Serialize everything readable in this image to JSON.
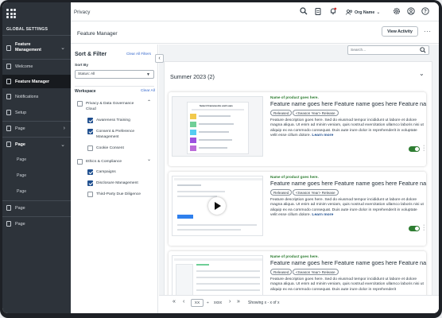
{
  "topbar": {
    "title": "Privacy",
    "org_name": "Org Name"
  },
  "sidebar": {
    "header": "GLOBAL SETTINGS",
    "items": [
      {
        "label": "Feature Management"
      },
      {
        "label": "Welcome"
      },
      {
        "label": "Feature Manager"
      },
      {
        "label": "Notifications"
      },
      {
        "label": "Setup"
      },
      {
        "label": "Page"
      },
      {
        "label": "Page"
      },
      {
        "label": "Page"
      },
      {
        "label": "Page"
      },
      {
        "label": "Page"
      },
      {
        "label": "Page"
      },
      {
        "label": "Page"
      }
    ]
  },
  "page": {
    "title": "Feature Manager",
    "view_activity": "View Activity"
  },
  "filter": {
    "title": "Sort & Filter",
    "clear_all": "Clear All Filters",
    "sort_label": "Sort By",
    "sort_value": "Status: All",
    "workspace_label": "Workspace",
    "workspace_clear": "Clear All",
    "groups": [
      {
        "label": "Privacy & Data Governance Cloud",
        "checked": false,
        "children": [
          {
            "label": "Awareness Training",
            "checked": true
          },
          {
            "label": "Consent & Preference Management",
            "checked": true
          },
          {
            "label": "Cookie Consent",
            "checked": false
          }
        ]
      },
      {
        "label": "Ethics & Compliance",
        "checked": false,
        "children": [
          {
            "label": "Campaigns",
            "checked": true
          },
          {
            "label": "Disclosure Management",
            "checked": true
          },
          {
            "label": "Third-Party Due Diligence",
            "checked": false
          }
        ]
      }
    ]
  },
  "main": {
    "search_placeholder": "Search...",
    "release_title": "Summer 2023 (2)",
    "cards": [
      {
        "product": "Name of product goes here.",
        "feature": "Feature name goes here Feature name goes here Feature na",
        "status": "Released",
        "season": "<Season Year> Release",
        "description": "Feature description goes here. Sed do eiusmod tempor incididunt ut labore et dolore magna aliqua. Ut enim ad minim veniam, quis nostrud exercitation ullamco laboris nisi ut aliquip ex ea commodo consequat. Duis aute irure dolor in reprehenderit in voluptate velit esse cillum dolore.",
        "learn_more": "Learn more",
        "thumb_heading": "Select Frameworks and Laws"
      },
      {
        "product": "Name of product goes here.",
        "feature": "Feature name goes here Feature name goes here Feature na",
        "status": "Released",
        "season": "<Season Year> Release",
        "description": "Feature description goes here. Sed do eiusmod tempor incididunt ut labore et dolore magna aliqua. Ut enim ad minim veniam, quis nostrud exercitation ullamco laboris nisi ut aliquip ex ea commodo consequat. Duis aute irure dolor in reprehenderit in voluptate velit esse cillum dolore.",
        "learn_more": "Learn more"
      },
      {
        "product": "Name of product goes here.",
        "feature": "Feature name goes here Feature name goes here Feature na",
        "status": "Released",
        "season": "<Season Year> Release",
        "description": "Feature description goes here. Sed do eiusmod tempor incididunt ut labore et dolore magna aliqua. Ut enim ad minim veniam, quis nostrud exercitation ullamco laboris nisi ut aliquip ex ea commodo consequat. Duis aute irure dolor in reprehenderit"
      }
    ]
  },
  "pager": {
    "page_value": "XX",
    "total": "xxxx",
    "showing": "Showing x - x of x"
  },
  "colors": {
    "sidebar_bg": "#2d333a",
    "accent_blue": "#1f4f8f",
    "green": "#2e7d32",
    "link": "#3366cc"
  }
}
